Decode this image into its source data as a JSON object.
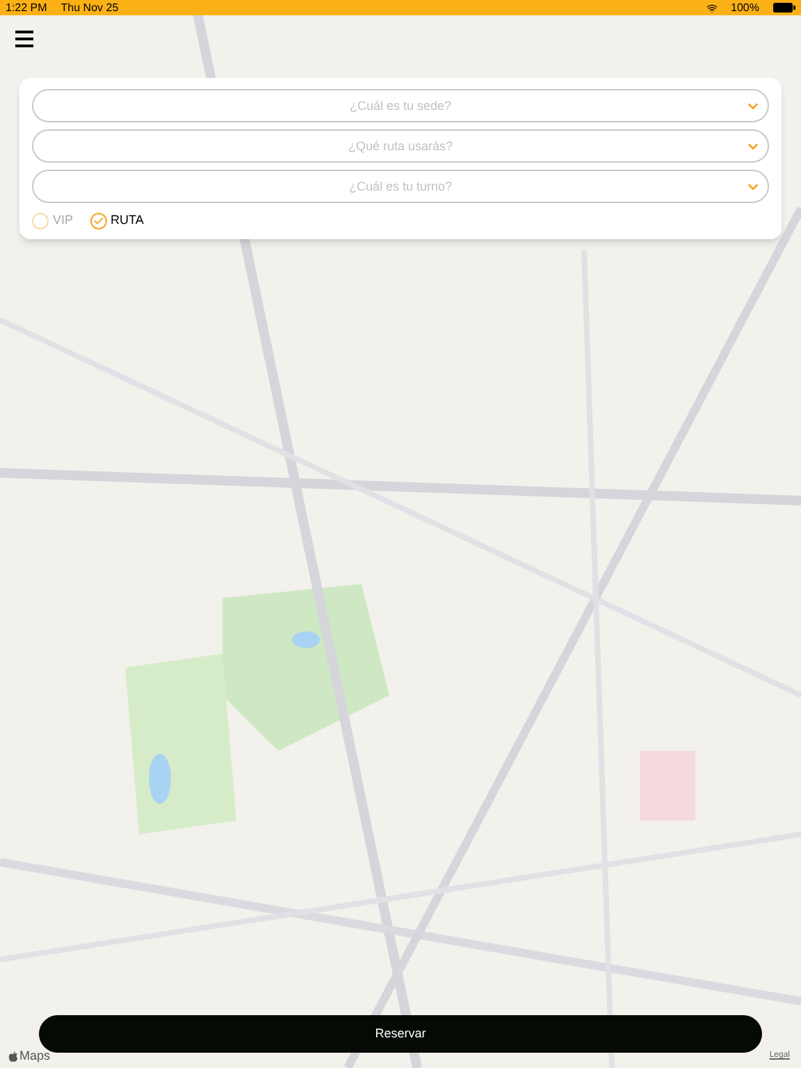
{
  "status_bar": {
    "time": "1:22 PM",
    "date": "Thu Nov 25",
    "battery": "100%"
  },
  "map": {
    "attribution": "Maps",
    "legal": "Legal"
  },
  "form": {
    "fields": [
      {
        "placeholder": "¿Cuál es tu sede?"
      },
      {
        "placeholder": "¿Qué ruta usarás?"
      },
      {
        "placeholder": "¿Cuál es tu turno?"
      }
    ],
    "options": [
      {
        "label": "VIP",
        "selected": false
      },
      {
        "label": "RUTA",
        "selected": true
      }
    ]
  },
  "button": "Reservar"
}
